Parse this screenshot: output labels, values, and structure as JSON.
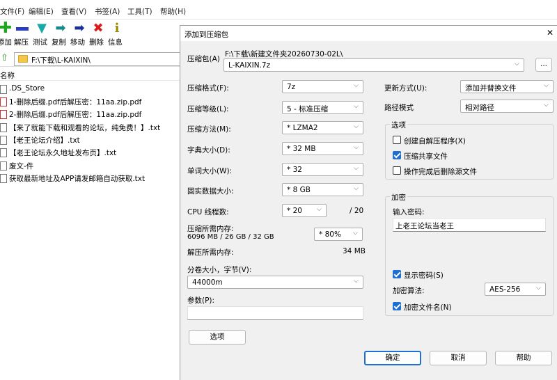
{
  "menu": [
    "文件(F)",
    "编辑(E)",
    "查看(V)",
    "书签(A)",
    "工具(T)",
    "帮助(H)"
  ],
  "toolbar": {
    "add": "添加",
    "extract": "解压",
    "test": "测试",
    "copy": "复制",
    "move": "移动",
    "delete": "删除",
    "info": "信息"
  },
  "address": "F:\\下载\\L-KAIXIN\\",
  "file_list": {
    "col_name": "名称",
    "files": [
      ".DS_Store",
      "1-删除后缀.pdf后解压密：11aa.zip.pdf",
      "2-删除后缀.pdf后解压密：11aa.zip.pdf",
      "【来了就能下载和观看的论坛，纯免费！】.txt",
      "【老王论坛介绍】.txt",
      "【老王论坛永久地址发布页】.txt",
      "废文-件",
      "获取最新地址及APP请发邮箱自动获取.txt"
    ]
  },
  "dialog": {
    "title": "添加到压缩包",
    "close": "✕",
    "archive_label": "压缩包(A)",
    "archive_path": "F:\\下载\\新建文件夹20260730-02L\\",
    "archive_name": "L-KAIXIN.7z",
    "browse": "...",
    "format_label": "压缩格式(F):",
    "format_value": "7z",
    "level_label": "压缩等级(L):",
    "level_value": "5 - 标准压缩",
    "method_label": "压缩方法(M):",
    "method_value": "*  LZMA2",
    "dict_label": "字典大小(D):",
    "dict_value": "*  32 MB",
    "word_label": "单词大小(W):",
    "word_value": "*  32",
    "solid_label": "固实数据大小:",
    "solid_value": "*  8 GB",
    "cpu_label": "CPU 线程数:",
    "cpu_value": "*  20",
    "cpu_total": "/ 20",
    "mem_comp_label": "压缩所需内存:",
    "mem_comp_value": "6096 MB / 26 GB / 32 GB",
    "mem_pct_value": "*  80%",
    "mem_decomp_label": "解压所需内存:",
    "mem_decomp_value": "34 MB",
    "split_label": "分卷大小，字节(V):",
    "split_value": "44000m",
    "params_label": "参数(P):",
    "options_button": "选项",
    "update_label": "更新方式(U):",
    "update_value": "添加并替换文件",
    "path_label": "路径模式",
    "path_value": "相对路径",
    "options_group": "选项",
    "opt_sfx": "创建自解压程序(X)",
    "opt_shared": "压缩共享文件",
    "opt_delete": "操作完成后删除源文件",
    "encrypt_group": "加密",
    "password_label": "输入密码:",
    "password_value": "上老王论坛当老王",
    "show_password": "显示密码(S)",
    "enc_method_label": "加密算法:",
    "enc_method_value": "AES-256",
    "enc_names": "加密文件名(N)",
    "ok": "确定",
    "cancel": "取消",
    "help": "帮助"
  },
  "colors": {
    "accent": "#1f6fd0",
    "dialog_bg": "#f0f0f0"
  }
}
